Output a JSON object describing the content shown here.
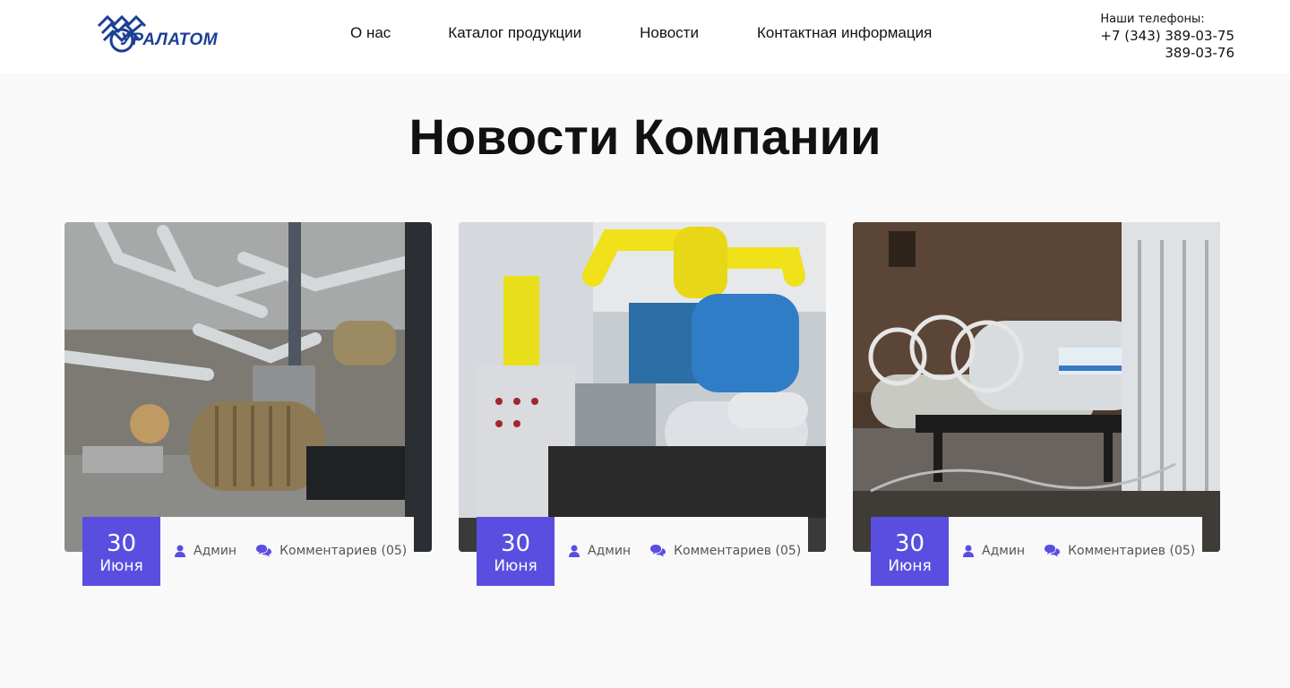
{
  "logo": {
    "text": "УРАЛАТОМ",
    "color": "#1c3f94"
  },
  "nav": {
    "items": [
      {
        "label": "О нас"
      },
      {
        "label": "Каталог продукции"
      },
      {
        "label": "Новости"
      },
      {
        "label": "Контактная информация"
      }
    ]
  },
  "contacts": {
    "label": "Наши телефоны:",
    "phone1": "+7 (343) 389-03-75",
    "phone2": "389-03-76"
  },
  "page": {
    "title": "Новости Компании"
  },
  "accent_color": "#5a4ee0",
  "news": [
    {
      "day": "30",
      "month": "Июня",
      "author": "Админ",
      "comments": "Комментариев (05)",
      "image": "pump-motors-photo"
    },
    {
      "day": "30",
      "month": "Июня",
      "author": "Админ",
      "comments": "Комментариев (05)",
      "image": "compressor-unit-photo"
    },
    {
      "day": "30",
      "month": "Июня",
      "author": "Админ",
      "comments": "Комментариев (05)",
      "image": "cryogenic-tank-photo"
    }
  ]
}
